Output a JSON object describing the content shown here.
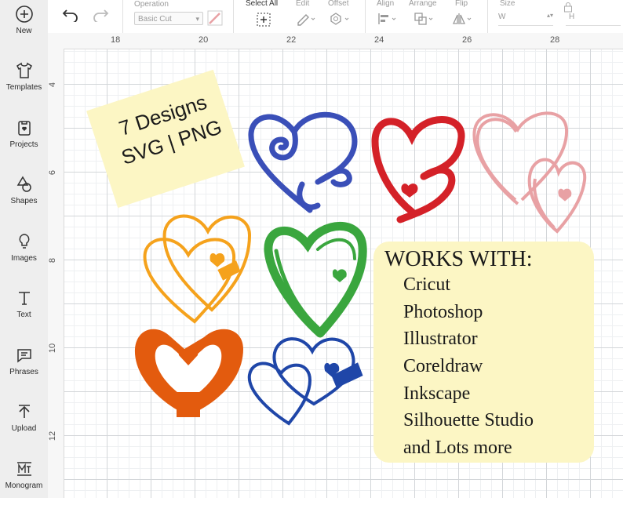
{
  "sidebar": {
    "items": [
      {
        "label": "New",
        "icon": "plus-circle-icon"
      },
      {
        "label": "Templates",
        "icon": "shirt-icon"
      },
      {
        "label": "Projects",
        "icon": "projects-icon"
      },
      {
        "label": "Shapes",
        "icon": "shapes-icon"
      },
      {
        "label": "Images",
        "icon": "lightbulb-icon"
      },
      {
        "label": "Text",
        "icon": "text-icon"
      },
      {
        "label": "Phrases",
        "icon": "speech-bubble-icon"
      },
      {
        "label": "Upload",
        "icon": "upload-icon"
      },
      {
        "label": "Monogram",
        "icon": "monogram-icon"
      }
    ]
  },
  "toolbar": {
    "operation_label": "Operation",
    "operation_value": "Basic Cut",
    "select_all_label": "Select All",
    "edit_label": "Edit",
    "offset_label": "Offset",
    "align_label": "Align",
    "arrange_label": "Arrange",
    "flip_label": "Flip",
    "size_label": "Size",
    "width_label": "W",
    "height_label": "H"
  },
  "ruler": {
    "top_ticks": [
      "18",
      "20",
      "22",
      "24",
      "26",
      "28"
    ],
    "left_ticks": [
      "4",
      "6",
      "8",
      "10",
      "12"
    ]
  },
  "design": {
    "note_line1": "7 Designs",
    "note_line2": "SVG | PNG",
    "works_title": "WORKS WITH:",
    "works_items": [
      "Cricut",
      "Photoshop",
      "Illustrator",
      "Coreldraw",
      "Inkscape",
      "Silhouette Studio",
      "and Lots more"
    ],
    "colors": {
      "blue": "#3a4fb8",
      "red": "#d42128",
      "pink": "#e8a1a4",
      "orange": "#f5a21c",
      "green": "#3aa63e",
      "dark_orange": "#e35b0e",
      "navy": "#1f46a8",
      "note_yellow": "#fcf6c4"
    }
  }
}
